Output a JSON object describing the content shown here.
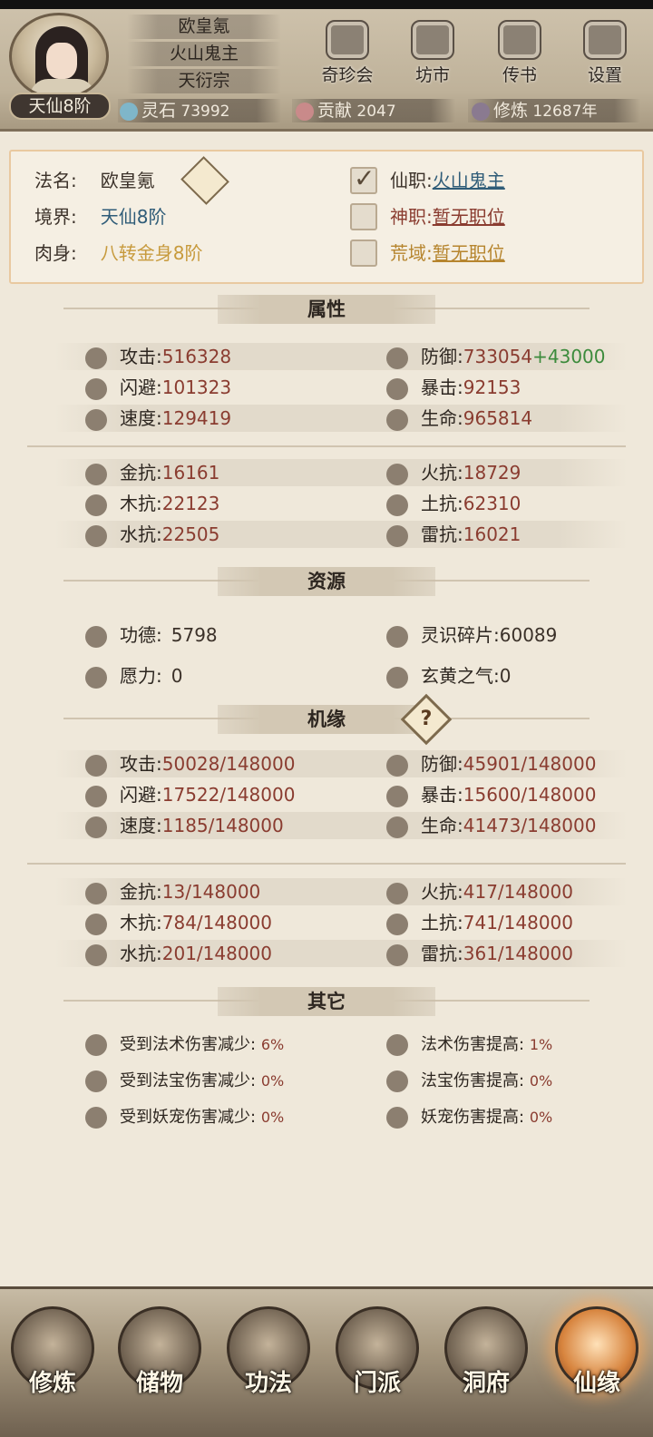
{
  "header": {
    "name": "欧皇氪",
    "title": "火山鬼主",
    "sect": "天衍宗",
    "rank": "天仙8阶",
    "buttons": [
      {
        "label": "奇珍会",
        "icon": "pavilion-icon"
      },
      {
        "label": "坊市",
        "icon": "money-bag-icon"
      },
      {
        "label": "传书",
        "icon": "scroll-icon"
      },
      {
        "label": "设置",
        "icon": "gear-icon"
      }
    ],
    "resources": [
      {
        "label": "灵石",
        "value": "73992",
        "color": "#7fb6c9"
      },
      {
        "label": "贡献",
        "value": "2047",
        "color": "#c98a8a"
      },
      {
        "label": "修炼",
        "value": "12687年",
        "color": "#8a7a90"
      }
    ]
  },
  "profile": {
    "dharma_name_label": "法名:",
    "dharma_name": "欧皇氪",
    "realm_label": "境界:",
    "realm": "天仙8阶",
    "body_label": "肉身:",
    "body": "八转金身8阶",
    "positions": [
      {
        "label": "仙职:",
        "value": "火山鬼主",
        "checked": true
      },
      {
        "label": "神职:",
        "value": "暂无职位",
        "checked": false
      },
      {
        "label": "荒域:",
        "value": "暂无职位",
        "checked": false
      }
    ]
  },
  "sections": {
    "attributes": "属性",
    "resources": "资源",
    "fortune": "机缘",
    "other": "其它"
  },
  "attributes": {
    "left": [
      {
        "label": "攻击:",
        "value": "516328"
      },
      {
        "label": "闪避:",
        "value": "101323"
      },
      {
        "label": "速度:",
        "value": "129419"
      }
    ],
    "right": [
      {
        "label": "防御:",
        "value": "733054",
        "bonus": "+43000"
      },
      {
        "label": "暴击:",
        "value": "92153"
      },
      {
        "label": "生命:",
        "value": "965814"
      }
    ],
    "resist_left": [
      {
        "label": "金抗:",
        "value": "16161"
      },
      {
        "label": "木抗:",
        "value": "22123"
      },
      {
        "label": "水抗:",
        "value": "22505"
      }
    ],
    "resist_right": [
      {
        "label": "火抗:",
        "value": "18729"
      },
      {
        "label": "土抗:",
        "value": "62310"
      },
      {
        "label": "雷抗:",
        "value": "16021"
      }
    ]
  },
  "resources": [
    {
      "label": "功德:",
      "value": "5798"
    },
    {
      "label": "灵识碎片:",
      "value": "60089"
    },
    {
      "label": "愿力:",
      "value": "0"
    },
    {
      "label": "玄黄之气:",
      "value": "0"
    }
  ],
  "fortune": {
    "help": "?",
    "left": [
      {
        "label": "攻击:",
        "value": "50028/148000"
      },
      {
        "label": "闪避:",
        "value": "17522/148000"
      },
      {
        "label": "速度:",
        "value": "1185/148000"
      }
    ],
    "right": [
      {
        "label": "防御:",
        "value": "45901/148000"
      },
      {
        "label": "暴击:",
        "value": "15600/148000"
      },
      {
        "label": "生命:",
        "value": "41473/148000"
      }
    ],
    "resist_left": [
      {
        "label": "金抗:",
        "value": "13/148000"
      },
      {
        "label": "木抗:",
        "value": "784/148000"
      },
      {
        "label": "水抗:",
        "value": "201/148000"
      }
    ],
    "resist_right": [
      {
        "label": "火抗:",
        "value": "417/148000"
      },
      {
        "label": "土抗:",
        "value": "741/148000"
      },
      {
        "label": "雷抗:",
        "value": "361/148000"
      }
    ]
  },
  "other": {
    "left": [
      {
        "label": "受到法术伤害减少:",
        "value": "6%"
      },
      {
        "label": "受到法宝伤害减少:",
        "value": "0%"
      },
      {
        "label": "受到妖宠伤害减少:",
        "value": "0%"
      }
    ],
    "right": [
      {
        "label": "法术伤害提高:",
        "value": "1%"
      },
      {
        "label": "法宝伤害提高:",
        "value": "0%"
      },
      {
        "label": "妖宠伤害提高:",
        "value": "0%"
      }
    ]
  },
  "nav": [
    {
      "label": "修炼"
    },
    {
      "label": "储物"
    },
    {
      "label": "功法"
    },
    {
      "label": "门派"
    },
    {
      "label": "洞府"
    },
    {
      "label": "仙缘",
      "active": true
    }
  ]
}
